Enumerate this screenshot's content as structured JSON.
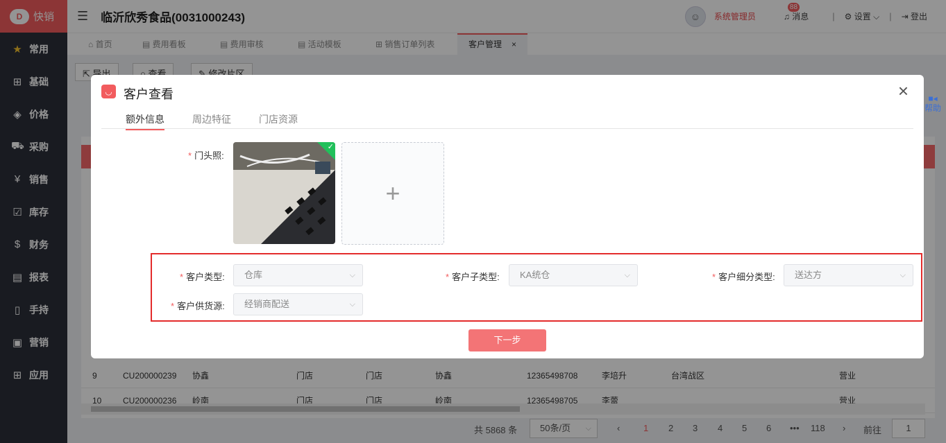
{
  "brand": {
    "logo_text": "快销"
  },
  "sidebar": {
    "items": [
      {
        "label": "常用",
        "icon": "star-icon"
      },
      {
        "label": "基础",
        "icon": "grid-icon"
      },
      {
        "label": "价格",
        "icon": "tag-icon"
      },
      {
        "label": "采购",
        "icon": "cart-icon"
      },
      {
        "label": "销售",
        "icon": "yen-icon"
      },
      {
        "label": "库存",
        "icon": "checkbox-icon"
      },
      {
        "label": "财务",
        "icon": "moneybag-icon"
      },
      {
        "label": "报表",
        "icon": "report-icon"
      },
      {
        "label": "手持",
        "icon": "handheld-icon"
      },
      {
        "label": "营销",
        "icon": "image-icon"
      },
      {
        "label": "应用",
        "icon": "apps-icon"
      }
    ]
  },
  "header": {
    "title": "临沂欣秀食品(0031000243)",
    "user": "系统管理员",
    "msg_label": "消息",
    "msg_badge": "88",
    "settings_label": "设置",
    "logout_label": "登出"
  },
  "tabs": [
    {
      "label": "首页"
    },
    {
      "label": "费用看板"
    },
    {
      "label": "费用审核"
    },
    {
      "label": "活动模板"
    },
    {
      "label": "销售订单列表"
    },
    {
      "label": "客户管理"
    }
  ],
  "toolbar": {
    "export": "导出",
    "view": "查看",
    "edit_area": "修改片区"
  },
  "table": {
    "rows": [
      [
        "9",
        "CU200000239",
        "协鑫",
        "门店",
        "门店",
        "协鑫",
        "12365498708",
        "李培升",
        "台湾战区",
        "",
        "营业"
      ],
      [
        "10",
        "CU200000236",
        "岭南",
        "门店",
        "门店",
        "岭南",
        "12365498705",
        "李蕾",
        "",
        "",
        "营业"
      ]
    ]
  },
  "pager": {
    "total": "共 5868 条",
    "page_size": "50条/页",
    "pages": [
      "1",
      "2",
      "3",
      "4",
      "5",
      "6",
      "•••",
      "118"
    ],
    "goto": "前往",
    "goto_value": "1"
  },
  "modal": {
    "title": "客户查看",
    "tabs": [
      "额外信息",
      "周边特征",
      "门店资源"
    ],
    "photo_label": "门头照:",
    "fields": {
      "customer_type": {
        "label": "客户类型:",
        "value": "仓库"
      },
      "customer_subtype": {
        "label": "客户子类型:",
        "value": "KA统仓"
      },
      "customer_detail_type": {
        "label": "客户细分类型:",
        "value": "送达方"
      },
      "supply_source": {
        "label": "客户供货源:",
        "value": "经销商配送"
      }
    },
    "next_button": "下一步"
  },
  "help": {
    "label": "帮助"
  }
}
